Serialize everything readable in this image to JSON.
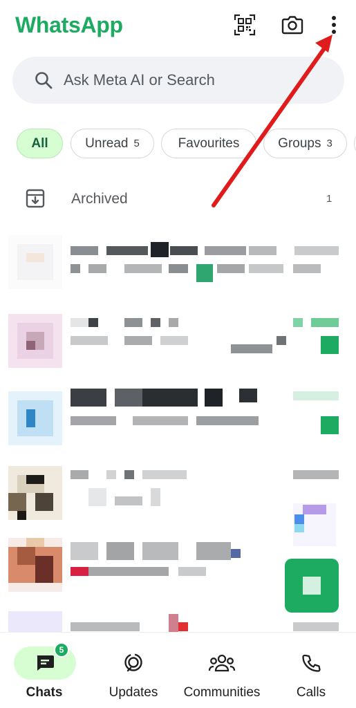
{
  "header": {
    "title": "WhatsApp",
    "icons": [
      "qr-scan-icon",
      "camera-icon",
      "more-options-icon"
    ]
  },
  "search": {
    "placeholder": "Ask Meta AI or Search"
  },
  "filters": [
    {
      "label": "All",
      "count": null,
      "active": true
    },
    {
      "label": "Unread",
      "count": "5",
      "active": false
    },
    {
      "label": "Favourites",
      "count": null,
      "active": false
    },
    {
      "label": "Groups",
      "count": "3",
      "active": false
    }
  ],
  "archived": {
    "label": "Archived",
    "count": "1"
  },
  "bottom_nav": {
    "chats": {
      "label": "Chats",
      "badge": "5"
    },
    "updates": {
      "label": "Updates"
    },
    "communities": {
      "label": "Communities"
    },
    "calls": {
      "label": "Calls"
    }
  },
  "colors": {
    "brand_green": "#1daa61",
    "active_chip_bg": "#d7fdd3",
    "annotation_red": "#e01b1b"
  }
}
